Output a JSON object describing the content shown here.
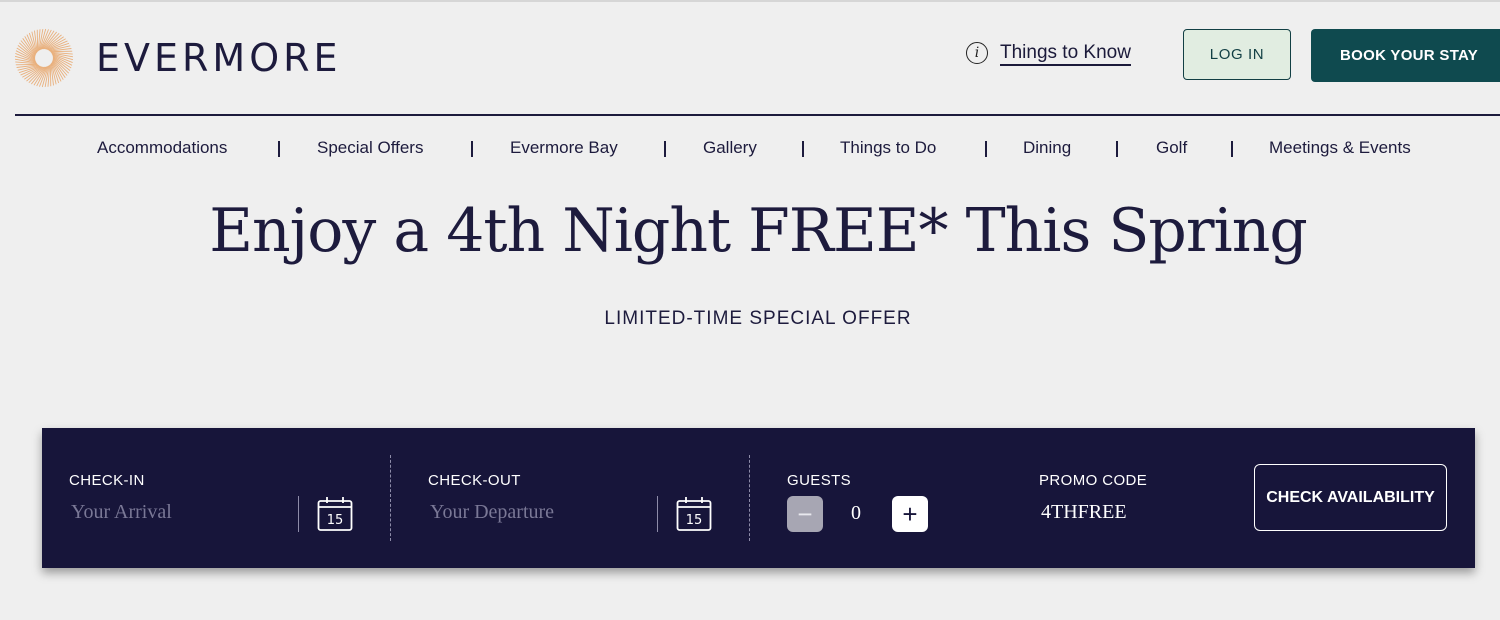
{
  "brand": {
    "name": "EVERMORE"
  },
  "header": {
    "things_to_know": "Things to Know",
    "login_label": "LOG IN",
    "book_label": "BOOK YOUR STAY"
  },
  "nav": {
    "items": [
      "Accommodations",
      "Special Offers",
      "Evermore Bay",
      "Gallery",
      "Things to Do",
      "Dining",
      "Golf",
      "Meetings & Events"
    ]
  },
  "hero": {
    "title": "Enjoy a 4th Night FREE* This Spring",
    "subtitle": "LIMITED-TIME SPECIAL OFFER"
  },
  "booking": {
    "checkin_label": "CHECK-IN",
    "checkin_placeholder": "Your Arrival",
    "checkout_label": "CHECK-OUT",
    "checkout_placeholder": "Your Departure",
    "calendar_day": "15",
    "guests_label": "GUESTS",
    "guests_minus": "−",
    "guests_value": "0",
    "guests_plus": "+",
    "promo_label": "PROMO CODE",
    "promo_value": "4THFREE",
    "check_label": "CHECK AVAILABILITY"
  },
  "colors": {
    "navy": "#17153a",
    "teal": "#0f4a4f",
    "login_bg": "#e1ede1",
    "logo_orange": "#e8a66a"
  },
  "icons": {
    "logo": "sunburst-logo-icon",
    "info": "info-icon",
    "calendar": "calendar-icon",
    "minus": "minus-icon",
    "plus": "plus-icon"
  }
}
